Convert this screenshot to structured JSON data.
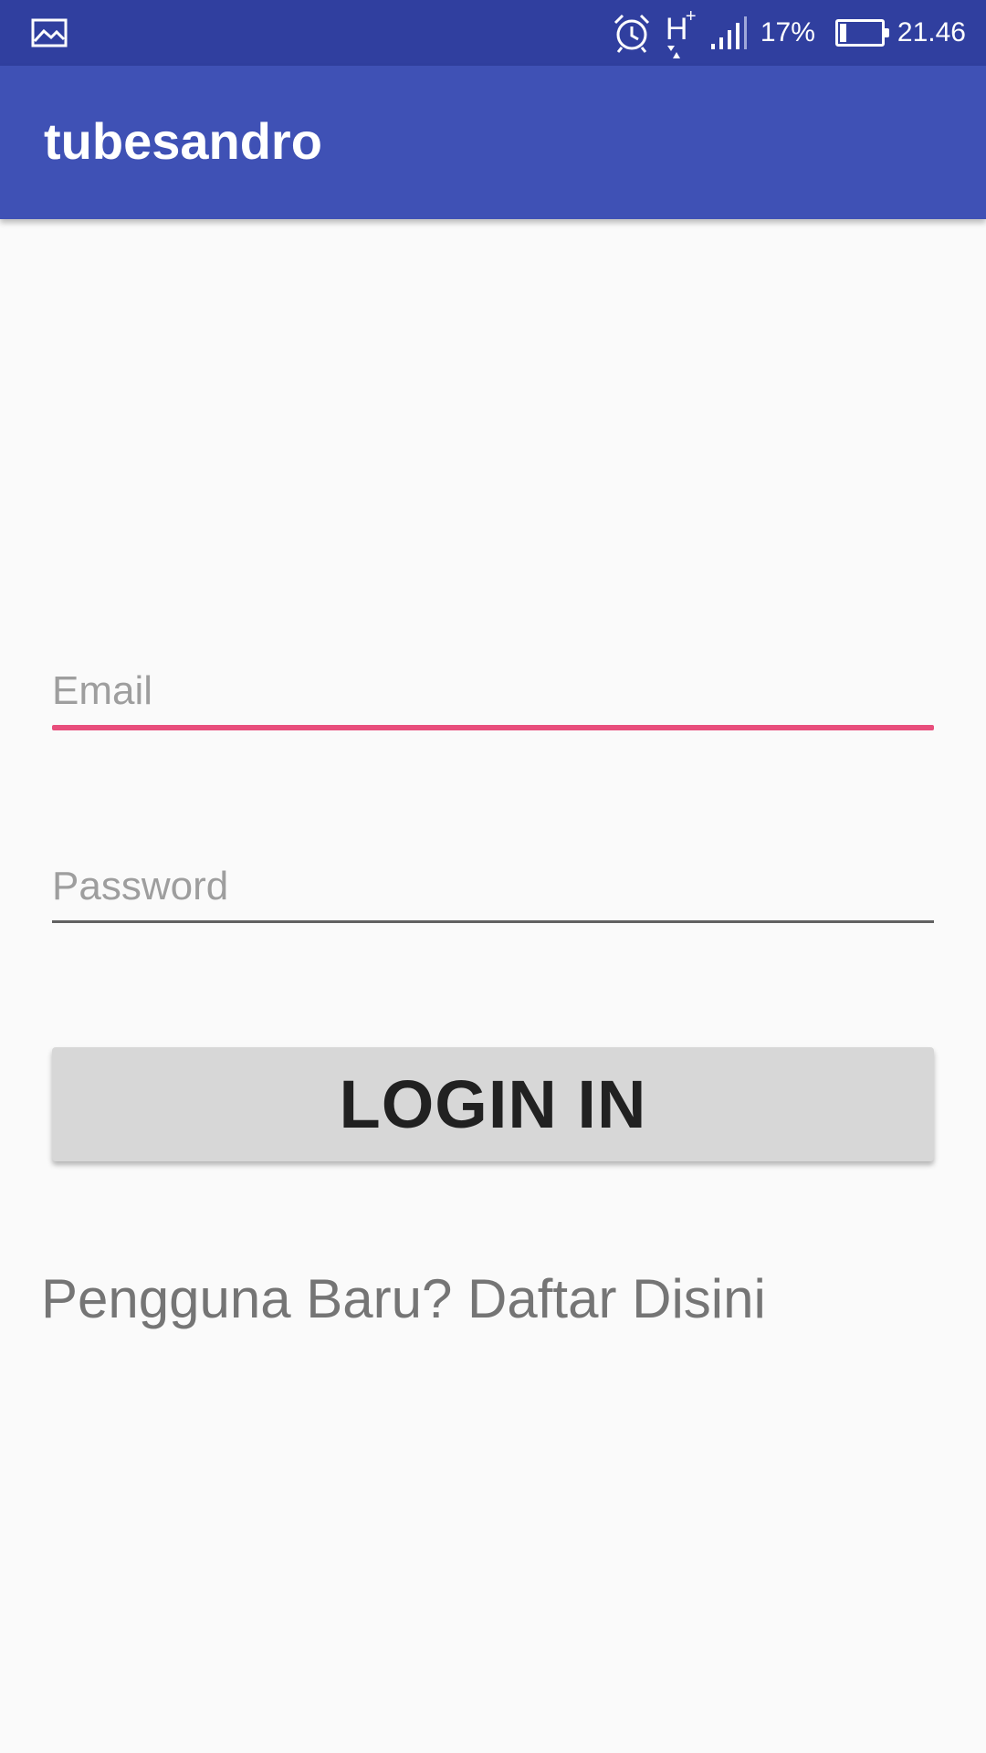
{
  "status_bar": {
    "notification_icon": "image-icon",
    "alarm_icon": "alarm-clock-icon",
    "network_type": "H",
    "network_plus": "+",
    "signal_icon": "cell-signal-icon",
    "battery_percent": "17%",
    "battery_level": 0.17,
    "time": "21.46"
  },
  "app_bar": {
    "title": "tubesandro"
  },
  "login_form": {
    "email_placeholder": "Email",
    "email_value": "",
    "password_placeholder": "Password",
    "password_value": "",
    "submit_label": "LOGIN IN",
    "register_link": "Pengguna Baru? Daftar Disini"
  },
  "colors": {
    "status_bar": "#303F9F",
    "app_bar": "#3F51B5",
    "accent": "#E84E7C",
    "background": "#FAFAFA",
    "button": "#D7D7D7"
  }
}
